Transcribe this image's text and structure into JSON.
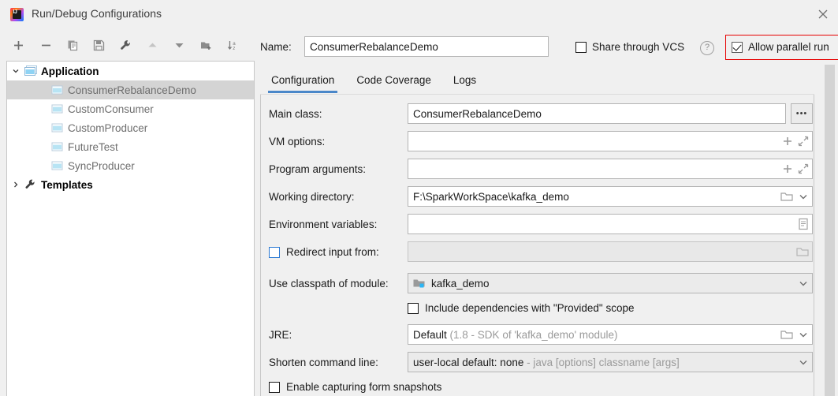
{
  "window": {
    "title": "Run/Debug Configurations",
    "logo_icon": "intellij-idea-logo-icon",
    "close_icon": "close-icon"
  },
  "toolbar": {
    "buttons": [
      {
        "name": "add-configuration-button",
        "icon": "plus-icon",
        "label": "+"
      },
      {
        "name": "remove-configuration-button",
        "icon": "minus-icon",
        "label": "−"
      },
      {
        "name": "copy-configuration-button",
        "icon": "copy-icon",
        "label": ""
      },
      {
        "name": "save-configuration-button",
        "icon": "save-icon",
        "label": ""
      },
      {
        "name": "edit-templates-button",
        "icon": "wrench-icon",
        "label": ""
      },
      {
        "name": "move-up-button",
        "icon": "arrow-up-icon",
        "label": ""
      },
      {
        "name": "move-down-button",
        "icon": "arrow-down-icon",
        "label": ""
      },
      {
        "name": "new-folder-button",
        "icon": "folder-add-icon",
        "label": ""
      },
      {
        "name": "sort-alphabetically-button",
        "icon": "sort-az-icon",
        "label": ""
      }
    ]
  },
  "sidebar": {
    "tree": [
      {
        "label": "Application",
        "type": "group",
        "expanded": true,
        "icon": "application-icon",
        "selected": false
      },
      {
        "label": "ConsumerRebalanceDemo",
        "type": "child",
        "icon": "application-icon",
        "selected": true
      },
      {
        "label": "CustomConsumer",
        "type": "child",
        "icon": "application-icon",
        "selected": false
      },
      {
        "label": "CustomProducer",
        "type": "child",
        "icon": "application-icon",
        "selected": false
      },
      {
        "label": "FutureTest",
        "type": "child",
        "icon": "application-icon",
        "selected": false
      },
      {
        "label": "SyncProducer",
        "type": "child",
        "icon": "application-icon",
        "selected": false
      },
      {
        "label": "Templates",
        "type": "group",
        "expanded": false,
        "icon": "wrench-icon",
        "selected": false
      }
    ]
  },
  "header": {
    "name_label": "Name:",
    "name_value": "ConsumerRebalanceDemo",
    "share_vcs_label": "Share through VCS",
    "share_vcs_checked": false,
    "help_icon": "help-question-icon",
    "help_glyph": "?",
    "allow_parallel_label": "Allow parallel run",
    "allow_parallel_checked": true,
    "highlight_color": "#e60000"
  },
  "tabs": [
    {
      "label": "Configuration",
      "active": true
    },
    {
      "label": "Code Coverage",
      "active": false
    },
    {
      "label": "Logs",
      "active": false
    }
  ],
  "form": {
    "main_class": {
      "label": "Main class:",
      "value": "ConsumerRebalanceDemo",
      "browse_label": "•••",
      "browse_icon": "ellipsis-browse-icon"
    },
    "vm_options": {
      "label": "VM options:",
      "value": "",
      "expand_icon": "expand-diagonal-icon",
      "add_icon": "plus-icon"
    },
    "program_arguments": {
      "label": "Program arguments:",
      "value": "",
      "expand_icon": "expand-diagonal-icon",
      "add_icon": "plus-icon"
    },
    "working_directory": {
      "label": "Working directory:",
      "value": "F:\\SparkWorkSpace\\kafka_demo",
      "folder_icon": "folder-icon",
      "dropdown_icon": "chevron-down-icon"
    },
    "environment_variables": {
      "label": "Environment variables:",
      "value": "",
      "list_icon": "list-edit-icon"
    },
    "redirect_input": {
      "label": "Redirect input from:",
      "checked": false,
      "value": "",
      "folder_icon": "folder-icon"
    },
    "use_classpath": {
      "label": "Use classpath of module:",
      "value": "kafka_demo",
      "module_icon": "module-folder-icon",
      "dropdown_icon": "chevron-down-icon"
    },
    "include_provided": {
      "label": "Include dependencies with \"Provided\" scope",
      "checked": false
    },
    "jre": {
      "label": "JRE:",
      "value": "Default",
      "hint": "(1.8 - SDK of 'kafka_demo' module)",
      "folder_icon": "folder-icon",
      "dropdown_icon": "chevron-down-icon"
    },
    "shorten_command_line": {
      "label": "Shorten command line:",
      "value": "user-local default: none",
      "hint": "- java [options] classname [args]",
      "dropdown_icon": "chevron-down-icon"
    },
    "enable_snapshots": {
      "label": "Enable capturing form snapshots",
      "checked": false
    }
  }
}
